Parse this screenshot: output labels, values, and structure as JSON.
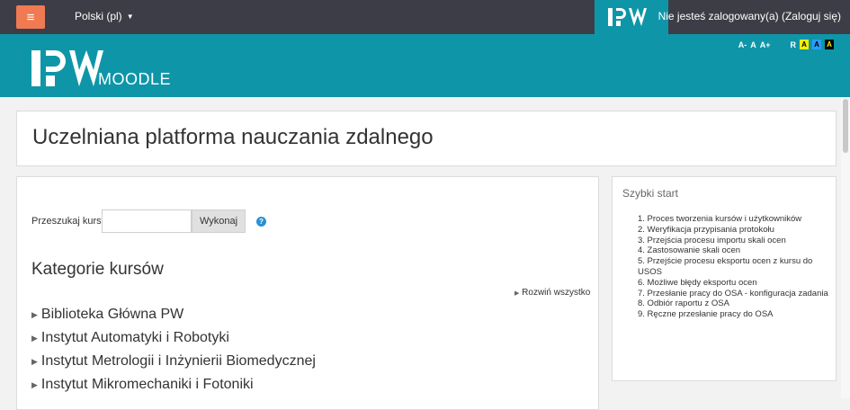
{
  "topbar": {
    "language": "Polski (pl)",
    "login_text": "Nie jesteś zalogowany(a) (Zaloguj się)"
  },
  "brand": {
    "moodle_word": "MOODLE",
    "font_controls": {
      "smaller": "A-",
      "normal": "A",
      "larger": "A+"
    },
    "contrast_controls": {
      "reset": "R",
      "yellow": "A",
      "blue": "A",
      "black": "A"
    }
  },
  "page": {
    "title": "Uczelniana platforma nauczania zdalnego"
  },
  "search": {
    "label": "Przeszukaj kursy",
    "value": "",
    "button": "Wykonaj"
  },
  "categories": {
    "heading": "Kategorie kursów",
    "expand_all": "Rozwiń wszystko",
    "items": [
      "Biblioteka Główna PW",
      "Instytut Automatyki i Robotyki",
      "Instytut Metrologii i Inżynierii Biomedycznej",
      "Instytut Mikromechaniki i Fotoniki"
    ]
  },
  "quick_start": {
    "title": "Szybki start",
    "items": [
      "1. Proces tworzenia kursów i użytkowników",
      "2. Weryfikacja przypisania protokołu",
      "3. Przejścia procesu importu skali ocen",
      "4. Zastosowanie skali ocen",
      "5. Przejście procesu eksportu ocen z kursu do USOS",
      "6. Możliwe błędy eksportu ocen",
      "7. Przesłanie pracy do OSA - konfiguracja zadania",
      "8. Odbiór raportu z OSA",
      "9. Ręczne przesłanie pracy do OSA"
    ]
  },
  "colors": {
    "topbar": "#3d3d47",
    "brand_teal": "#0e96a8",
    "menu_button": "#f07a52"
  }
}
